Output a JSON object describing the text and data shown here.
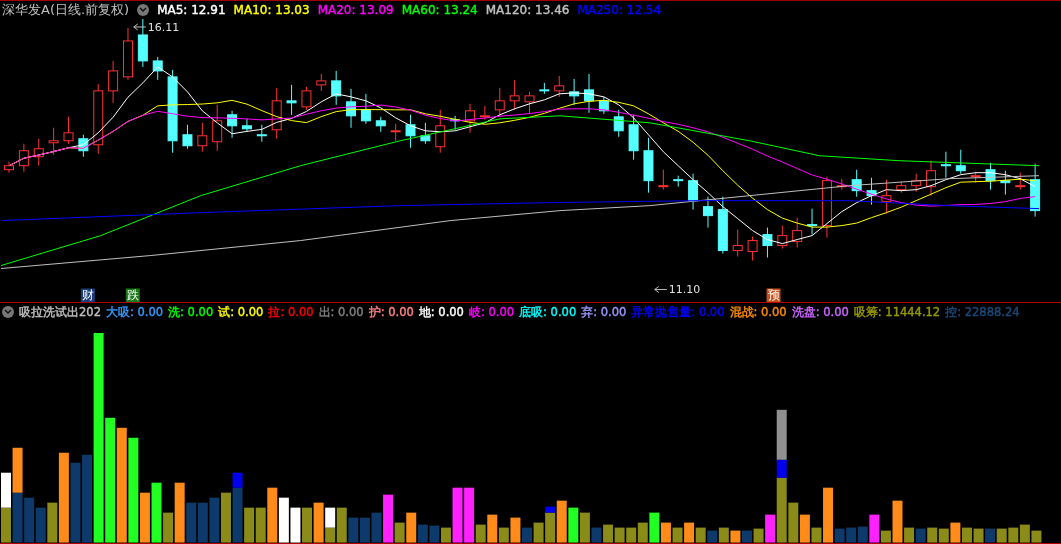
{
  "title": "深华发A(日线.前复权)",
  "ma_readings": [
    {
      "text": "MA5: 12.91",
      "color": "#ffffff"
    },
    {
      "text": "MA10: 13.03",
      "color": "#ffff00"
    },
    {
      "text": "MA20: 13.09",
      "color": "#ff00ff"
    },
    {
      "text": "MA60: 13.24",
      "color": "#00ff00"
    },
    {
      "text": "MA120: 13.46",
      "color": "#c0c0c0"
    },
    {
      "text": "MA250: 12.54",
      "color": "#0000ff"
    }
  ],
  "price_labels": [
    {
      "kind": "high",
      "text": "16.11"
    },
    {
      "kind": "low",
      "text": "11.10"
    }
  ],
  "event_markers": [
    {
      "text": "财",
      "color": "#1a3d7a"
    },
    {
      "text": "跌",
      "color": "#1a7a1a"
    },
    {
      "text": "预",
      "color": "#c8501a"
    }
  ],
  "indicator": {
    "name": "吸拉洗试出202",
    "readings": [
      {
        "text": "大吸: 0.00",
        "color": "#3399ff"
      },
      {
        "text": "洗: 0.00",
        "color": "#00ff00"
      },
      {
        "text": "试: 0.00",
        "color": "#ffff00"
      },
      {
        "text": "拉: 0.00",
        "color": "#ff0000"
      },
      {
        "text": "出: 0.00",
        "color": "#808080"
      },
      {
        "text": "护: 0.00",
        "color": "#ff8080"
      },
      {
        "text": "地: 0.00",
        "color": "#ffffff"
      },
      {
        "text": "岐: 0.00",
        "color": "#ff00ff"
      },
      {
        "text": "底吸: 0.00",
        "color": "#00ffff"
      },
      {
        "text": "弃: 0.00",
        "color": "#9999ff"
      },
      {
        "text": "异常抛售量: 0.00",
        "color": "#0000ff"
      },
      {
        "text": "混战: 0.00",
        "color": "#ff8c00"
      },
      {
        "text": "洗盘: 0.00",
        "color": "#cc66ff"
      },
      {
        "text": "吸筹: 11444.12",
        "color": "#999900"
      },
      {
        "text": "控: 22888.24",
        "color": "#1a4a7a"
      }
    ]
  }
}
